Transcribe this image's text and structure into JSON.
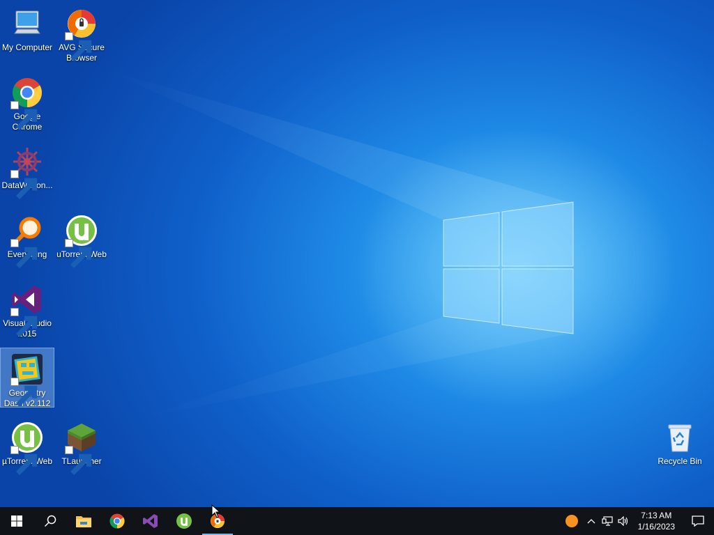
{
  "desktop": {
    "icons": [
      {
        "label": "My Computer",
        "icon": "my-computer-icon"
      },
      {
        "label": "AVG Secure Browser",
        "icon": "avg-secure-browser-icon"
      },
      {
        "label": "Google Chrome",
        "icon": "google-chrome-icon"
      },
      {
        "label": "DataWagon...",
        "icon": "datawagon-icon"
      },
      {
        "label": "Everything",
        "icon": "everything-search-icon"
      },
      {
        "label": "uTorrent Web",
        "icon": "utorrent-web-icon"
      },
      {
        "label": "Visual Studio 2015",
        "icon": "visual-studio-icon"
      },
      {
        "label": "Geometry Dash v2.112",
        "icon": "geometry-dash-icon"
      },
      {
        "label": "µTorrent Web",
        "icon": "utorrent-web-icon"
      },
      {
        "label": "TLauncher",
        "icon": "tlauncher-icon"
      },
      {
        "label": "Recycle Bin",
        "icon": "recycle-bin-icon"
      }
    ],
    "selected_icon": "Geometry Dash v2.112"
  },
  "taskbar": {
    "buttons": [
      {
        "icon": "windows-start-icon"
      },
      {
        "icon": "search-icon"
      },
      {
        "icon": "file-explorer-icon"
      },
      {
        "icon": "google-chrome-icon"
      },
      {
        "icon": "visual-studio-icon"
      },
      {
        "icon": "utorrent-icon"
      },
      {
        "icon": "avg-secure-browser-icon",
        "active": true
      }
    ],
    "tray": {
      "icons": [
        "orange-status-icon",
        "chevron-up-icon",
        "network-icon",
        "volume-icon"
      ],
      "time": "7:13 AM",
      "date": "1/16/2023",
      "notification_icon": "action-center-icon"
    }
  },
  "colors": {
    "wallpaper": "#1e88e5",
    "taskbar": "#101418",
    "utorrent_green": "#4caf50",
    "vs_purple": "#68217a"
  }
}
